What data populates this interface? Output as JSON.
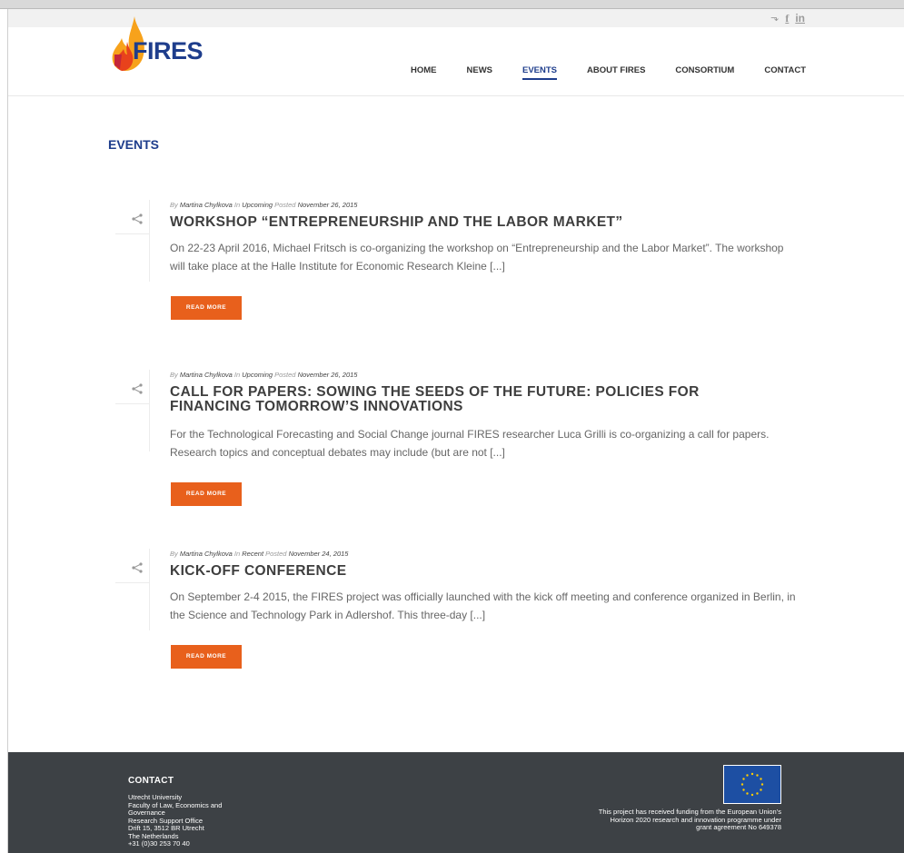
{
  "social": {
    "twitter_icon": "twitter-icon",
    "facebook_icon": "facebook-icon",
    "linkedin_icon": "linkedin-icon",
    "twitter_glyph": "⬎",
    "facebook_glyph": "f",
    "linkedin_glyph": "in"
  },
  "logo": {
    "text": "FIRES"
  },
  "nav": {
    "items": [
      {
        "label": "HOME"
      },
      {
        "label": "NEWS"
      },
      {
        "label": "EVENTS",
        "active": true
      },
      {
        "label": "ABOUT FIRES"
      },
      {
        "label": "CONSORTIUM"
      },
      {
        "label": "CONTACT"
      }
    ]
  },
  "page": {
    "heading": "EVENTS"
  },
  "posts": [
    {
      "by_label": "By",
      "author": "Martina Chylkova",
      "in_label": "In",
      "category": "Upcoming",
      "posted_label": "Posted",
      "date": "November 26, 2015",
      "title": "WORKSHOP “ENTREPRENEURSHIP AND THE LABOR MARKET”",
      "excerpt": "On 22-23 April 2016, Michael Fritsch is co-organizing the workshop on “Entrepreneurship and the Labor Market”. The workshop will take place at the Halle Institute for Economic Research Kleine [...]",
      "button": "READ MORE"
    },
    {
      "by_label": "By",
      "author": "Martina Chylkova",
      "in_label": "In",
      "category": "Upcoming",
      "posted_label": "Posted",
      "date": "November 26, 2015",
      "title": "CALL FOR PAPERS: SOWING THE SEEDS OF THE FUTURE: POLICIES FOR FINANCING TOMORROW’S INNOVATIONS",
      "excerpt": "For the Technological Forecasting and Social Change journal FIRES researcher Luca Grilli is co-organizing a call for papers. Research topics and conceptual debates may include (but are not [...]",
      "button": "READ MORE"
    },
    {
      "by_label": "By",
      "author": "Martina Chylkova",
      "in_label": "In",
      "category": "Recent",
      "posted_label": "Posted",
      "date": "November 24, 2015",
      "title": "KICK-OFF CONFERENCE",
      "excerpt": "On September 2-4 2015, the FIRES project was officially launched with the kick off meeting and conference organized in Berlin, in the Science and Technology Park in Adlershof. This three-day [...]",
      "button": "READ MORE"
    }
  ],
  "footer": {
    "title": "CONTACT",
    "address": [
      "Utrecht University",
      "Faculty of Law, Economics and",
      "Governance",
      "Research Support Office",
      "Drift 15, 3512 BR Utrecht",
      "The Netherlands",
      "+31 (0)30 253 70 40"
    ],
    "funding": [
      "This project has received funding from the European Union’s",
      "Horizon 2020 research and innovation programme under",
      "grant agreement No 649378"
    ]
  },
  "colors": {
    "brand_blue": "#1e3d8c",
    "button_orange": "#e8601c",
    "footer_bg": "#3d4145",
    "eu_blue": "#1d4fa3",
    "eu_star": "#ffcc00"
  }
}
